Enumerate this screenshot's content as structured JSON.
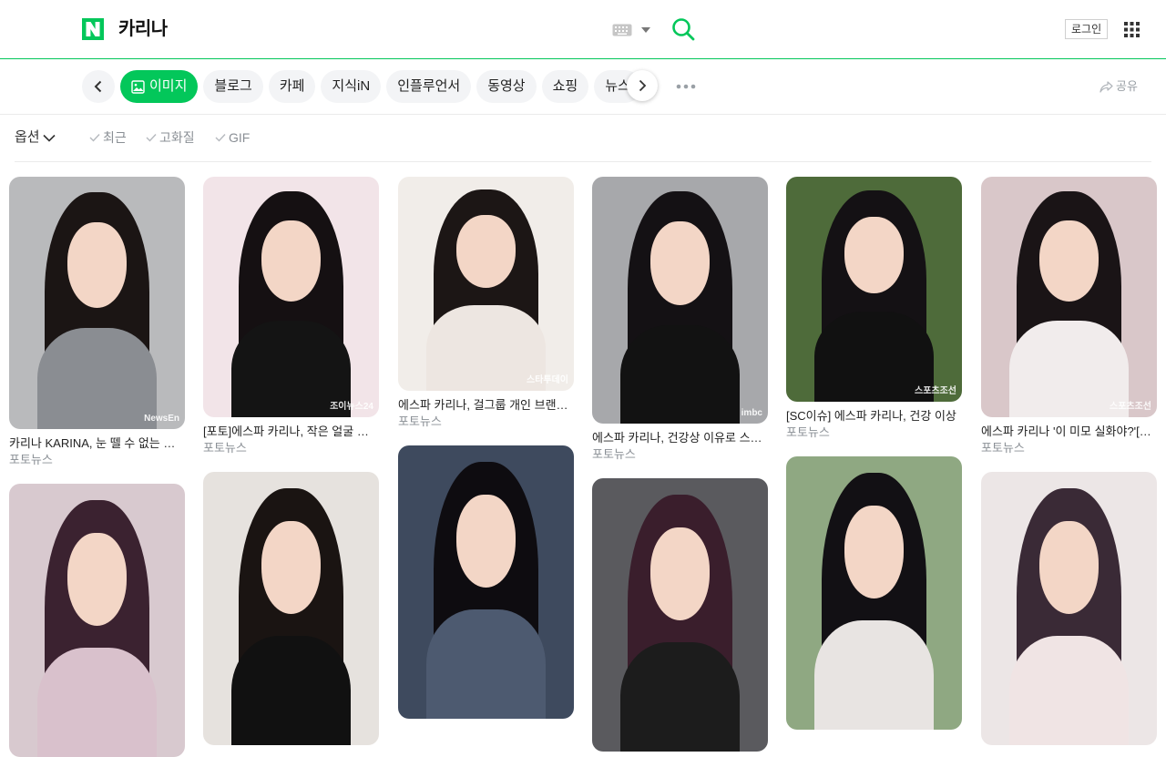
{
  "header": {
    "query": "카리나",
    "login_label": "로그인",
    "brand_color": "#03c75a"
  },
  "tabs": [
    {
      "label": "이미지",
      "active": true,
      "icon": "image-icon"
    },
    {
      "label": "블로그",
      "active": false
    },
    {
      "label": "카페",
      "active": false
    },
    {
      "label": "지식iN",
      "active": false
    },
    {
      "label": "인플루언서",
      "active": false
    },
    {
      "label": "동영상",
      "active": false
    },
    {
      "label": "쇼핑",
      "active": false
    },
    {
      "label": "뉴스",
      "active": false
    }
  ],
  "share_label": "공유",
  "filters": {
    "option_label": "옵션",
    "chips": [
      "최근",
      "고화질",
      "GIF"
    ]
  },
  "images": {
    "columns": [
      [
        {
          "title": "카리나 KARINA, 눈 뗄 수 없는 미모",
          "source": "포토뉴스",
          "watermark": "NewsEn",
          "bg": "#b9babc",
          "hair": "#1b1514",
          "body": "#8a8d92"
        },
        {
          "title": "",
          "source": "",
          "watermark": "",
          "bg": "#d8c9cf",
          "hair": "#3b2230",
          "body": "#d9c1cc"
        }
      ],
      [
        {
          "title": "[포토]에스파 카리나, 작은 얼굴 하트",
          "source": "포토뉴스",
          "watermark": "조이뉴스24",
          "bg": "#f2e4e8",
          "hair": "#151012",
          "body": "#141414"
        },
        {
          "title": "",
          "source": "",
          "watermark": "",
          "bg": "#e6e2de",
          "hair": "#1a1412",
          "body": "#111111"
        }
      ],
      [
        {
          "title": "에스파 카리나, 걸그룹 개인 브랜드평판",
          "source": "포토뉴스",
          "watermark": "스타투데이",
          "bg": "#f1ede9",
          "hair": "#1c1615",
          "body": "#ede6e1"
        },
        {
          "title": "",
          "source": "",
          "watermark": "",
          "bg": "#3e4a5e",
          "hair": "#0e0c10",
          "body": "#4d5a70"
        }
      ],
      [
        {
          "title": "에스파 카리나, 건강상 이유로 스케줄",
          "source": "포토뉴스",
          "watermark": "imbc",
          "bg": "#a7a8ab",
          "hair": "#141114",
          "body": "#121212"
        },
        {
          "title": "",
          "source": "",
          "watermark": "",
          "bg": "#5a5a5e",
          "hair": "#3a1e2c",
          "body": "#1c1c1c"
        }
      ],
      [
        {
          "title": "[SC이슈] 에스파 카리나, 건강 이상",
          "source": "포토뉴스",
          "watermark": "스포츠조선",
          "bg": "#4e6b3a",
          "hair": "#141114",
          "body": "#111111"
        },
        {
          "title": "",
          "source": "",
          "watermark": "",
          "bg": "#8fa882",
          "hair": "#121014",
          "body": "#e8e4e2"
        }
      ],
      [
        {
          "title": "에스파 카리나 '이 미모 실화야?'[포토]",
          "source": "포토뉴스",
          "watermark": "스포츠조선",
          "bg": "#d9c7c9",
          "hair": "#1a1416",
          "body": "#f1ecec"
        },
        {
          "title": "",
          "source": "",
          "watermark": "",
          "bg": "#ece6e6",
          "hair": "#3a2a36",
          "body": "#f0e4e4"
        }
      ]
    ]
  }
}
